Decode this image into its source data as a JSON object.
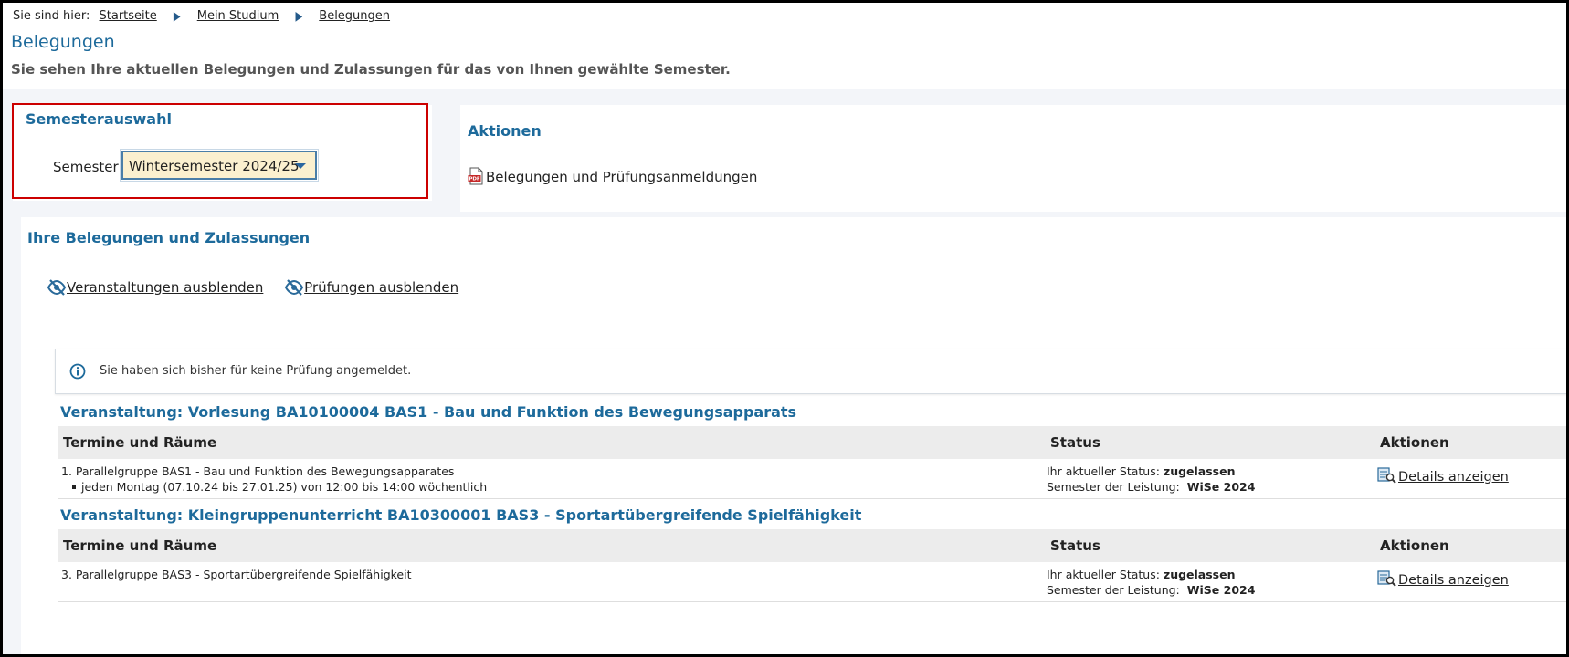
{
  "breadcrumb": {
    "prefix": "Sie sind hier:",
    "items": [
      "Startseite",
      "Mein Studium",
      "Belegungen"
    ]
  },
  "page": {
    "title": "Belegungen",
    "subtitle": "Sie sehen Ihre aktuellen Belegungen und Zulassungen für das von Ihnen gewählte Semester."
  },
  "semester_panel": {
    "title": "Semesterauswahl",
    "label": "Semester",
    "selected": "Wintersemester 2024/25"
  },
  "actions_panel": {
    "title": "Aktionen",
    "pdf_link": "Belegungen und Prüfungsanmeldungen"
  },
  "main_panel": {
    "title": "Ihre Belegungen und Zulassungen",
    "hide_courses": "Veranstaltungen ausblenden",
    "hide_exams": "Prüfungen ausblenden",
    "info": "Sie haben sich bisher für keine Prüfung angemeldet."
  },
  "columns": {
    "dates_rooms": "Termine und Räume",
    "status": "Status",
    "actions": "Aktionen"
  },
  "courses": [
    {
      "title": "Veranstaltung: Vorlesung BA10100004 BAS1 - Bau und Funktion des Bewegungsapparats",
      "group": "1. Parallelgruppe BAS1 - Bau und Funktion des Bewegungsapparates",
      "schedule": "jeden Montag (07.10.24 bis 27.01.25) von 12:00 bis 14:00 wöchentlich",
      "status_label": "Ihr aktueller Status:",
      "status_value": "zugelassen",
      "semester_label": "Semester der Leistung:",
      "semester_value": "WiSe 2024",
      "details": "Details anzeigen"
    },
    {
      "title": "Veranstaltung: Kleingruppenunterricht BA10300001 BAS3 - Sportartübergreifende Spielfähigkeit",
      "group": "3. Parallelgruppe BAS3 - Sportartübergreifende Spielfähigkeit",
      "status_label": "Ihr aktueller Status:",
      "status_value": "zugelassen",
      "semester_label": "Semester der Leistung:",
      "semester_value": "WiSe 2024",
      "details": "Details anzeigen"
    }
  ],
  "colors": {
    "accent": "#1d6a9b",
    "highlight_border": "#cc0000",
    "select_bg": "#fbf0cf"
  }
}
